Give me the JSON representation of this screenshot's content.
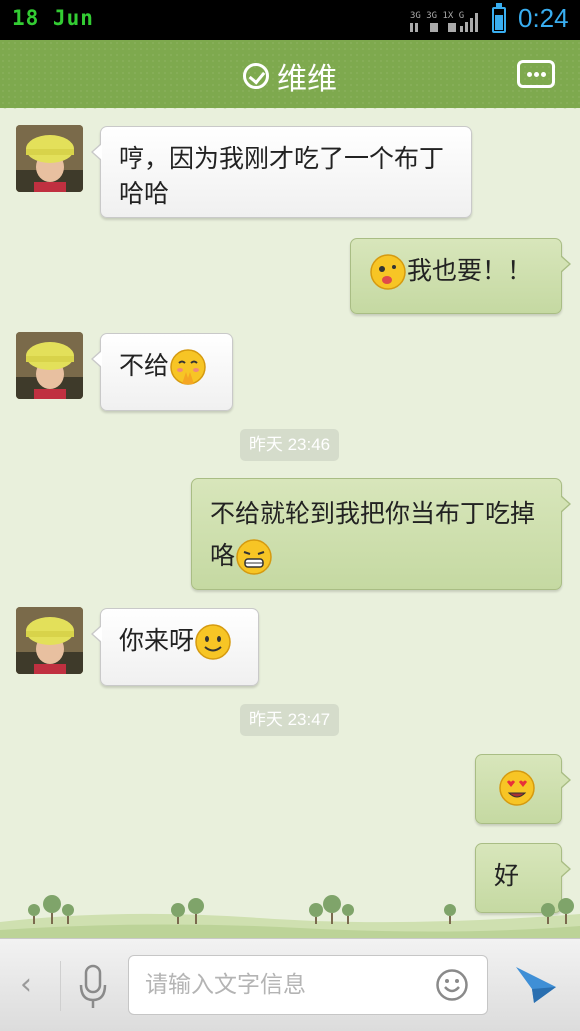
{
  "status_bar": {
    "date": "18 Jun",
    "network": "3G 3G 1X G",
    "time": "0:24",
    "icons": [
      "signal-icon",
      "battery-icon"
    ]
  },
  "header": {
    "title": "维维",
    "left_icon": "check-circle-icon",
    "right_icon": "more-menu-icon",
    "bg_color": "#7ea94e"
  },
  "messages": [
    {
      "side": "in",
      "text": "哼，因为我刚才吃了一个布丁哈哈",
      "emoji": null
    },
    {
      "side": "out",
      "text": "我也要！！",
      "emoji": "tongue-face-emoji"
    },
    {
      "side": "in",
      "text": "不给",
      "emoji": "shy-hands-emoji"
    },
    {
      "side": "time",
      "text": "昨天 23:46"
    },
    {
      "side": "out",
      "text": "不给就轮到我把你当布丁吃掉咯",
      "emoji": "grin-emoji"
    },
    {
      "side": "in",
      "text": "你来呀",
      "emoji": "smile-emoji"
    },
    {
      "side": "time",
      "text": "昨天 23:47"
    },
    {
      "side": "out",
      "text": "",
      "emoji": "heart-eyes-emoji"
    },
    {
      "side": "out",
      "text": "好",
      "emoji": null
    }
  ],
  "input_bar": {
    "back_glyph": "‹",
    "placeholder": "请输入文字信息",
    "icons": [
      "voice-mic-icon",
      "emoji-smiley-icon",
      "send-icon"
    ]
  },
  "colors": {
    "chat_bg": "#e9f0dc",
    "outgoing_bubble": "#cfe0b0",
    "incoming_bubble": "#ffffff",
    "status_accent": "#39aef0"
  }
}
